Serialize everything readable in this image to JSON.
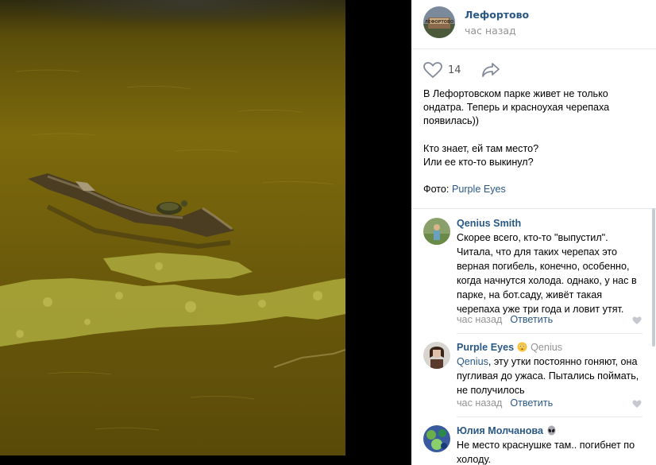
{
  "post": {
    "group_name": "Лефортово",
    "time": "час назад",
    "avatar_text": "ЛЕФОРТОВО",
    "likes": "14",
    "text_lines": [
      "В Лефортовском парке живет не только",
      "ондатра. Теперь и красноухая черепаха",
      "появилась))",
      "",
      "Кто знает, ей там место?",
      "Или ее кто-то выкинул?",
      "",
      "Фото: "
    ],
    "photo_credit_link": "Purple Eyes"
  },
  "comments": [
    {
      "author": "Qenius Smith",
      "text": "Скорее всего, кто-то \"выпустил\". Читала, что для таких черепах это верная погибель, конечно, особенно, когда начнутся холода. однако, у нас в парке, на бот.саду, живёт такая черепаха уже три года и ловит утят.",
      "time": "час назад",
      "reply_label": "Ответить"
    },
    {
      "author": "Purple Eyes",
      "emoji": "flushed-face-icon",
      "reply_to": "Qenius",
      "mention": "Qenius",
      "text": ", эту утки постоянно гоняют, она пугливая до ужаса. Пытались поймать, не получилось",
      "time": "час назад",
      "reply_label": "Ответить"
    },
    {
      "author": "Юлия Молчанова",
      "emoji": "alien-icon",
      "text": "Не место краснушке там.. погибнет по холоду."
    }
  ],
  "colors": {
    "link": "#2a5885",
    "muted": "#939393",
    "divider": "#e7e8ec",
    "water": "#7a6a0c",
    "algae": "#a8a53a"
  }
}
